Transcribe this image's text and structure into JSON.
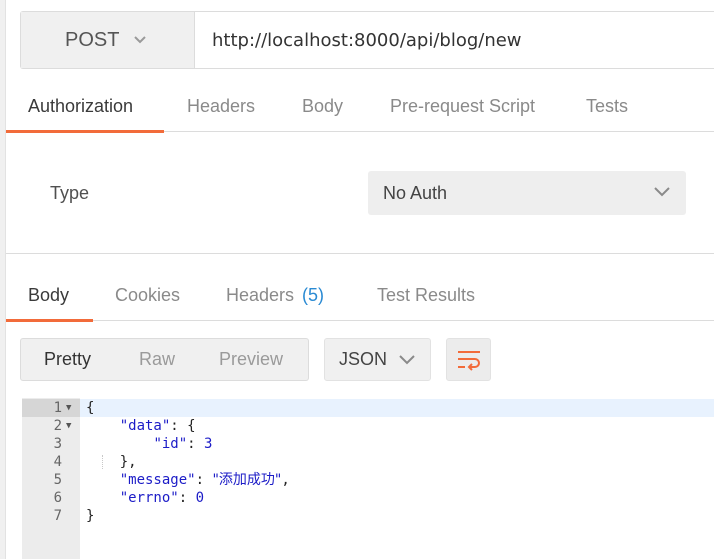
{
  "request": {
    "method": "POST",
    "url": "http://localhost:8000/api/blog/new"
  },
  "request_tabs": [
    {
      "label": "Authorization"
    },
    {
      "label": "Headers"
    },
    {
      "label": "Body"
    },
    {
      "label": "Pre-request Script"
    },
    {
      "label": "Tests"
    }
  ],
  "auth": {
    "type_label": "Type",
    "type_value": "No Auth"
  },
  "response_tabs": {
    "body": "Body",
    "cookies": "Cookies",
    "headers": "Headers",
    "headers_count": "(5)",
    "test_results": "Test Results"
  },
  "toolbar": {
    "pretty": "Pretty",
    "raw": "Raw",
    "preview": "Preview",
    "format": "JSON"
  },
  "response_body": {
    "line_numbers": [
      "1",
      "2",
      "3",
      "4",
      "5",
      "6",
      "7"
    ],
    "l1": "{",
    "l2_key": "\"data\"",
    "l2_rest": ": {",
    "l3_key": "\"id\"",
    "l3_sep": ": ",
    "l3_val": "3",
    "l4": "},",
    "l5_key": "\"message\"",
    "l5_sep": ": ",
    "l5_val": "\"添加成功\"",
    "l5_end": ",",
    "l6_key": "\"errno\"",
    "l6_sep": ": ",
    "l6_val": "0",
    "l7": "}"
  },
  "colors": {
    "accent": "#f26b3a",
    "count": "#2a8ad3",
    "json_value": "#1c1cc7"
  },
  "icons": {
    "method_dropdown": "chevron-down-icon",
    "auth_dropdown": "chevron-down-icon",
    "format_dropdown": "chevron-down-icon",
    "wrap": "wrap-lines-icon"
  }
}
